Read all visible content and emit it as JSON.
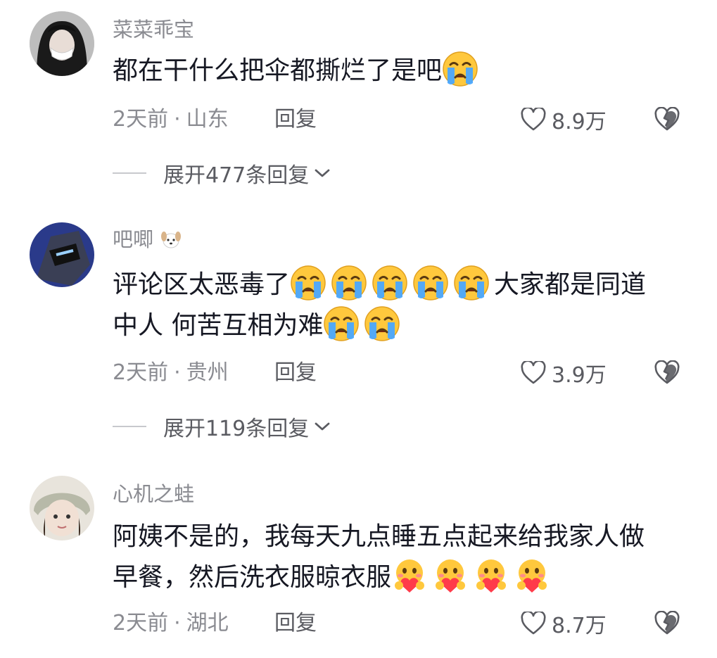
{
  "comments": [
    {
      "username": "菜菜乖宝",
      "text_parts": [
        "都在干什么把伞都撕烂了是吧"
      ],
      "time": "2天前",
      "separator": "·",
      "location": "山东",
      "reply_label": "回复",
      "likes": "8.9万",
      "expand_label": "展开477条回复",
      "emojis": [
        "crying-emoji"
      ]
    },
    {
      "username": "吧唧",
      "username_emoji": "puppy-emoji",
      "text_line1": "评论区太恶毒了",
      "text_line1_after": "大家都是同道",
      "text_line2": "中人 何苦互相为难",
      "time": "2天前",
      "separator": "·",
      "location": "贵州",
      "reply_label": "回复",
      "likes": "3.9万",
      "expand_label": "展开119条回复",
      "emojis": [
        "crying-emoji",
        "crying-emoji",
        "crying-emoji",
        "crying-emoji",
        "crying-emoji",
        "crying-emoji",
        "crying-emoji"
      ]
    },
    {
      "username": "心机之蛙",
      "text_line1": "阿姨不是的，我每天九点睡五点起来给我家人做",
      "text_line2": "早餐，然后洗衣服晾衣服",
      "time": "2天前",
      "separator": "·",
      "location": "湖北",
      "reply_label": "回复",
      "likes": "8.7万",
      "emojis": [
        "heart-hug-emoji",
        "heart-hug-emoji",
        "heart-hug-emoji",
        "heart-hug-emoji"
      ]
    }
  ],
  "colors": {
    "text": "#161823",
    "secondary": "#8a8b91",
    "action": "#5a5b61"
  }
}
